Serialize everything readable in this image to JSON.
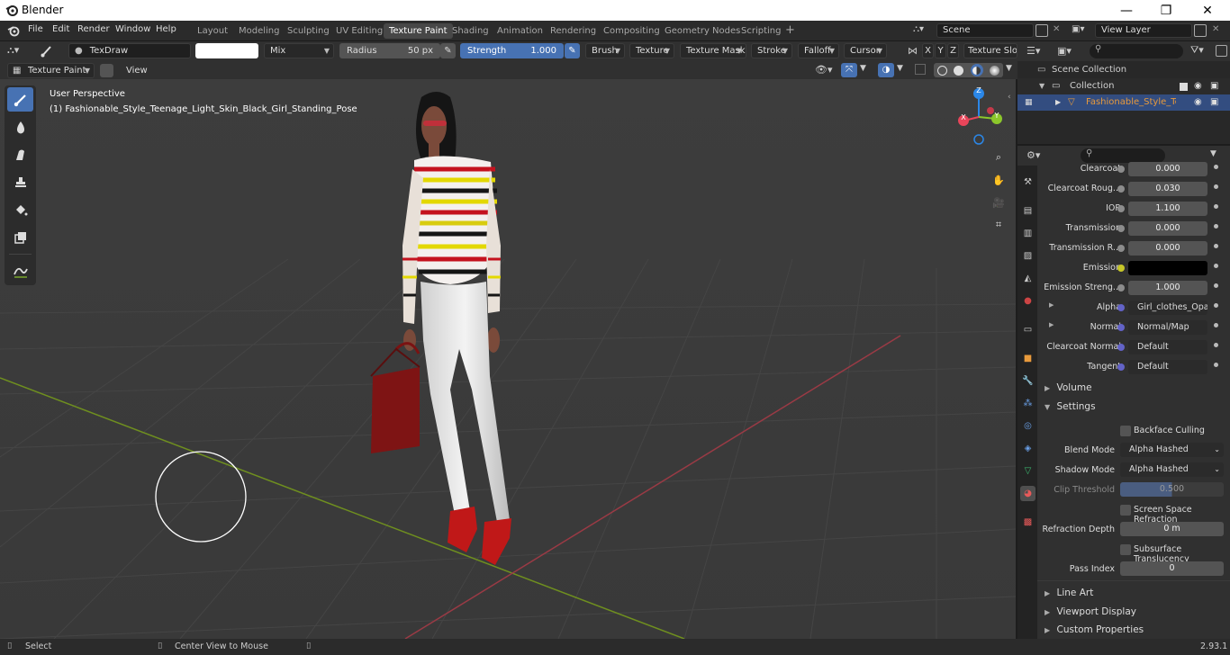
{
  "window": {
    "title": "Blender",
    "minimize": "—",
    "maximize": "❐",
    "close": "✕"
  },
  "menus": [
    "File",
    "Edit",
    "Render",
    "Window",
    "Help"
  ],
  "workspaces": [
    "Layout",
    "Modeling",
    "Sculpting",
    "UV Editing",
    "Texture Paint",
    "Shading",
    "Animation",
    "Rendering",
    "Compositing",
    "Geometry Nodes",
    "Scripting"
  ],
  "active_workspace": "Texture Paint",
  "add_workspace": "+",
  "scene": "Scene",
  "view_layer": "View Layer",
  "tool_header": {
    "brush_name": "TexDraw",
    "blend_mode": "Mix",
    "radius_label": "Radius",
    "radius_value": "50 px",
    "strength_label": "Strength",
    "strength_value": "1.000",
    "menus": [
      "Brush",
      "Texture",
      "Texture Mask",
      "Stroke",
      "Falloff",
      "Cursor"
    ],
    "axes": [
      "X",
      "Y",
      "Z"
    ],
    "texture_slots": "Texture Slots"
  },
  "header2": {
    "mode": "Texture Paint",
    "view": "View"
  },
  "viewport": {
    "perspective": "User Perspective",
    "object_name": "(1) Fashionable_Style_Teenage_Light_Skin_Black_Girl_Standing_Pose",
    "gizmo": {
      "x": "X",
      "y": "Y",
      "z": "Z"
    }
  },
  "outliner": {
    "scene_collection": "Scene Collection",
    "collection": "Collection",
    "object": "Fashionable_Style_Teena"
  },
  "properties": {
    "rows": [
      {
        "label": "Clearcoat",
        "value": "0.000",
        "socket": "#8c8c8c"
      },
      {
        "label": "Clearcoat Roug...",
        "value": "0.030",
        "socket": "#8c8c8c"
      },
      {
        "label": "IOR",
        "value": "1.100",
        "socket": "#8c8c8c"
      },
      {
        "label": "Transmission",
        "value": "0.000",
        "socket": "#8c8c8c"
      },
      {
        "label": "Transmission R...",
        "value": "0.000",
        "socket": "#8c8c8c"
      },
      {
        "label": "Emission",
        "value": "",
        "socket": "#c7c729"
      },
      {
        "label": "Emission Streng...",
        "value": "1.000",
        "socket": "#8c8c8c"
      },
      {
        "label": "Alpha",
        "value": "Girl_clothes_Opacity...",
        "socket": "#6363c7"
      },
      {
        "label": "Normal",
        "value": "Normal/Map",
        "socket": "#6363c7"
      },
      {
        "label": "Clearcoat Normal",
        "value": "Default",
        "socket": "#6363c7"
      },
      {
        "label": "Tangent",
        "value": "Default",
        "socket": "#6363c7"
      }
    ],
    "panels": {
      "volume": "Volume",
      "settings": "Settings",
      "line_art": "Line Art",
      "viewport_display": "Viewport Display",
      "custom_properties": "Custom Properties"
    },
    "settings": {
      "backface_culling": "Backface Culling",
      "blend_mode_label": "Blend Mode",
      "blend_mode_value": "Alpha Hashed",
      "shadow_mode_label": "Shadow Mode",
      "shadow_mode_value": "Alpha Hashed",
      "clip_threshold_label": "Clip Threshold",
      "clip_threshold_value": "0.500",
      "ssr": "Screen Space Refraction",
      "refraction_depth_label": "Refraction Depth",
      "refraction_depth_value": "0 m",
      "subsurface": "Subsurface Translucency",
      "pass_index_label": "Pass Index",
      "pass_index_value": "0"
    }
  },
  "statusbar": {
    "select": "Select",
    "center": "Center View to Mouse",
    "version": "2.93.1"
  },
  "colors": {
    "accent": "#4772b3",
    "viewport": "#3d3d3d",
    "axis_x": "#e8455a",
    "axis_y": "#8cc72b",
    "axis_z": "#2b87e8"
  }
}
